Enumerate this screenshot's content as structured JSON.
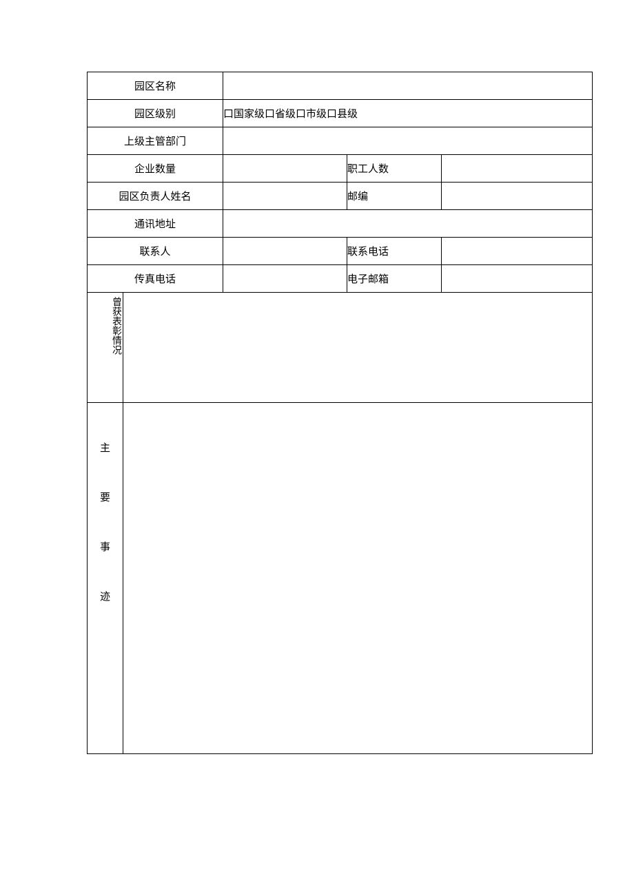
{
  "form": {
    "rows": {
      "park_name": {
        "label": "园区名称",
        "value": ""
      },
      "park_level": {
        "label": "园区级别",
        "value": "口国家级口省级口市级口县级"
      },
      "supervisor_dept": {
        "label": "上级主管部门",
        "value": ""
      },
      "enterprise_count": {
        "label": "企业数量",
        "value": "",
        "label2": "职工人数",
        "value2": ""
      },
      "leader_name": {
        "label": "园区负责人姓名",
        "value": "",
        "label2": "邮编",
        "value2": ""
      },
      "address": {
        "label": "通讯地址",
        "value": ""
      },
      "contact": {
        "label": "联系人",
        "value": "",
        "label2": "联系电话",
        "value2": ""
      },
      "fax": {
        "label": "传真电话",
        "value": "",
        "label2": "电子邮箱",
        "value2": ""
      },
      "commendation": {
        "label": "曾获表彰情况",
        "value": ""
      },
      "deeds": {
        "c1": "主",
        "c2": "要",
        "c3": "事",
        "c4": "迹",
        "value": ""
      }
    }
  }
}
